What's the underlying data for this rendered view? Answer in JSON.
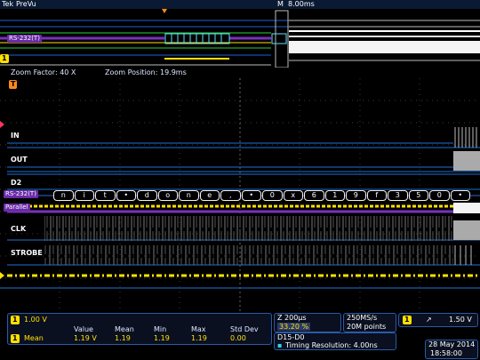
{
  "topbar": {
    "brand": "Tek",
    "title": "PreVu",
    "marker": "M",
    "timebase": "8.00ms"
  },
  "overview": {
    "rs232_label": "RS-232(T)",
    "channel_badge": "1"
  },
  "zoom": {
    "factor": "Zoom Factor: 40 X",
    "position": "Zoom Position: 19.9ms"
  },
  "channels": [
    {
      "label": "IN"
    },
    {
      "label": "OUT"
    },
    {
      "label": "D2"
    },
    {
      "label": "CLK"
    },
    {
      "label": "STROBE"
    }
  ],
  "bus": {
    "rs232_label": "RS-232(T)",
    "parallel_label": "Parallel",
    "decode_chars": [
      "n",
      "i",
      "t",
      "•",
      "d",
      "o",
      "n",
      "e",
      ",",
      "•",
      "0",
      "x",
      "6",
      "1",
      "9",
      "f",
      "3",
      "5",
      "0",
      "•"
    ]
  },
  "bottom": {
    "ch1_badge": "1",
    "ch1_scale": "1.00 V",
    "measurement": {
      "badge": "1",
      "name": "Mean",
      "headers": [
        "Value",
        "Mean",
        "Min",
        "Max",
        "Std Dev"
      ],
      "values": [
        "1.19 V",
        "1.19",
        "1.19",
        "1.19",
        "0.00"
      ]
    },
    "zoom_time": "Z 200μs",
    "zoom_pct": "33.20 %",
    "sample_rate": "250MS/s",
    "record_length": "20M points",
    "trigger_badge": "1",
    "trigger_level": "1.50 V",
    "digital_range": "D15-D0",
    "timing_resolution": "Timing Resolution: 4.00ns",
    "date": "28 May 2014",
    "time": "18:58:00"
  },
  "colors": {
    "yellow": "#ffe000",
    "purple": "#7b2fbf",
    "cyan": "#33d6e6",
    "green": "#2bd23a",
    "blue": "#1f6fd6"
  }
}
